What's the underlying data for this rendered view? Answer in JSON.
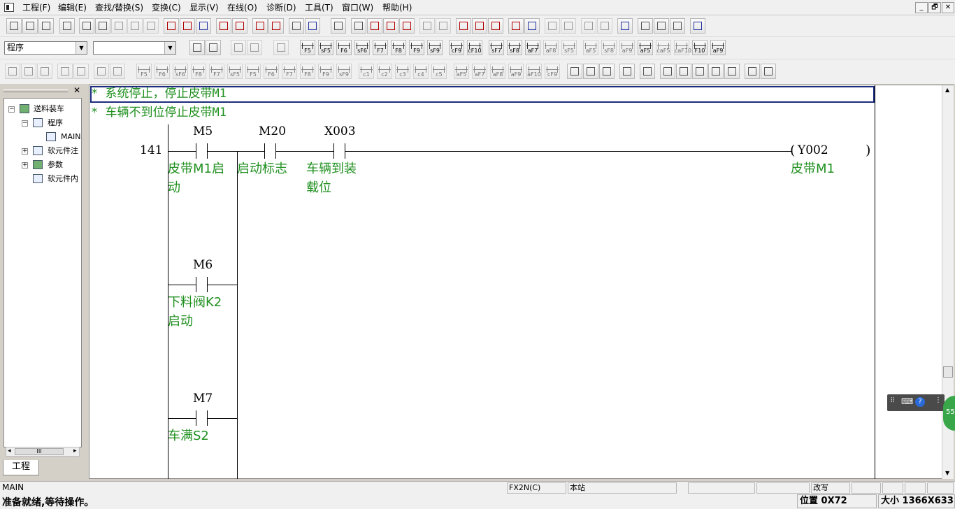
{
  "menu": {
    "items": [
      "工程(F)",
      "编辑(E)",
      "查找/替换(S)",
      "变换(C)",
      "显示(V)",
      "在线(O)",
      "诊断(D)",
      "工具(T)",
      "窗口(W)",
      "帮助(H)"
    ]
  },
  "window_buttons": [
    "_",
    "🗗",
    "✕"
  ],
  "toolbar3": {
    "program_select": "程序",
    "second_select": ""
  },
  "ladder_keys": [
    "F5",
    "sF5",
    "F6",
    "sF6",
    "F7",
    "F8",
    "F9",
    "sF9",
    "cF9",
    "cF10",
    "sF7",
    "sF8",
    "aF7",
    "aF8",
    "sF5",
    "aF5",
    "sF8",
    "aF9",
    "aF5",
    "caF5",
    "caF10",
    "F10",
    "aF9"
  ],
  "ladder_keys2": [
    "F5",
    "F6",
    "sF6",
    "F8",
    "F7",
    "sF5",
    "F5",
    "F6",
    "F7",
    "F8",
    "F9",
    "sF9",
    "c1",
    "c2",
    "c3",
    "c4",
    "c5",
    "aF5",
    "aF7",
    "aF8",
    "aF9",
    "aF10",
    "cF9"
  ],
  "tree": {
    "close": "✕",
    "items": [
      "送料装车",
      "程序",
      "MAIN",
      "软元件注",
      "参数",
      "软元件内"
    ],
    "tab": "工程",
    "hscroll": "III"
  },
  "editor": {
    "comments": [
      "* 系统停止，停止皮带M1",
      "* 车辆不到位停止皮带M1"
    ],
    "step": "141",
    "contacts": [
      {
        "device": "M5",
        "c1": "皮带M1启",
        "c2": "动"
      },
      {
        "device": "M20",
        "c1": "启动标志",
        "c2": ""
      },
      {
        "device": "X003",
        "c1": "车辆到装",
        "c2": "载位"
      },
      {
        "device": "M6",
        "c1": "下料阀K2",
        "c2": "启动"
      },
      {
        "device": "M7",
        "c1": "车满S2",
        "c2": ""
      }
    ],
    "coil": {
      "device": "Y002",
      "comment": "皮带M1",
      "open": "(",
      "close": ")"
    }
  },
  "ime": {
    "badge": "55"
  },
  "status": {
    "program": "MAIN",
    "plc": "FX2N(C)",
    "station": "本站",
    "mode": "改写",
    "ready": "准备就绪,等待操作。",
    "position": "位置 0X72",
    "size": "大小 1366X633"
  }
}
